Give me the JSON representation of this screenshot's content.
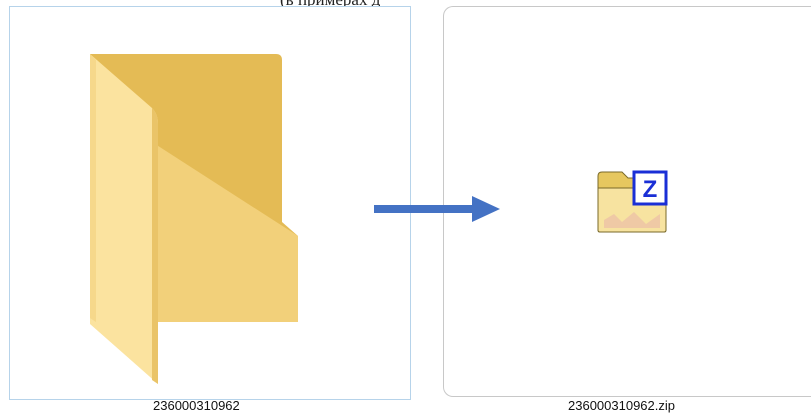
{
  "caption": "(в примерах д",
  "items": [
    {
      "name": "236000310962",
      "type": "folder-icon"
    },
    {
      "name": "236000310962.zip",
      "type": "zip-archive-icon"
    }
  ],
  "colors": {
    "folder_back": "#e8bf58",
    "folder_front": "#f6d98a",
    "arrow": "#4472c4",
    "zip_badge": "#1a2fd6"
  },
  "zip_badge_letter": "Z"
}
